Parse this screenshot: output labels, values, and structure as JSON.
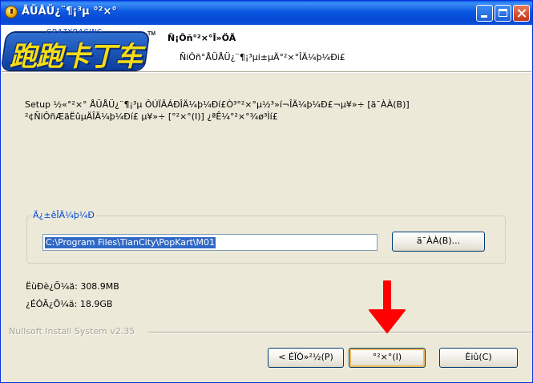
{
  "window": {
    "title": "ÅÜÅÜ¿¨¶¡³µ °²×°",
    "controls": {
      "minimize": "minimize",
      "maximize": "maximize",
      "close": "close"
    }
  },
  "header": {
    "logo_text": "跑跑卡丁车",
    "logo_tagline": "CRAZYRACING",
    "logo_tm": "TM",
    "title": "Ñ¡Ôñ°²×°Î»ÖÃ",
    "subtitle": "ÑiÔñ°ÅÜÅÜ¿¨¶¡³µi±µÄ°²×°ÎÄ¼þ¼Ði£"
  },
  "description": {
    "line1": "Setup ½«°²×° ÅÜÅÜ¿¨¶¡³µ ÔÚÏÂÁÐÎÄ¼þ¼Ðí£Ò³°²×°µ½³»í¬ÎÄ¼þ¼Ð£¬µ¥»÷ [ä¯ÀÀ(B)]",
    "line2": "²¢ÑiÔñÆäËûµÄÎÄ¼þ¼Ðí£ µ¥»÷ [°²×°(I)] ¿ªÊ¼°²×°¾ø³Ìí£"
  },
  "destination": {
    "group_label": "Ä¿±êÎÄ¼þ¼Ð",
    "path": "C:\\Program Files\\TianCity\\PopKart\\M01",
    "browse_label": "ä¯ÀÀ(B)..."
  },
  "space": {
    "required": "ËùÐè¿Õ¼ä: 308.9MB",
    "available": "¿ÉÓÃ¿Õ¼ä: 18.9GB"
  },
  "footer": {
    "brand": "Nullsoft Install System v2.35",
    "back_label": "< ÉÏÒ»²½(P)",
    "install_label": "°²×°(I)",
    "cancel_label": "Èiû(C)"
  },
  "colors": {
    "titlebar": "#0a58e2",
    "dialog_bg": "#ece9d8",
    "accent_arrow": "#ff0000",
    "group_label": "#0046d5",
    "selection": "#316ac5"
  }
}
